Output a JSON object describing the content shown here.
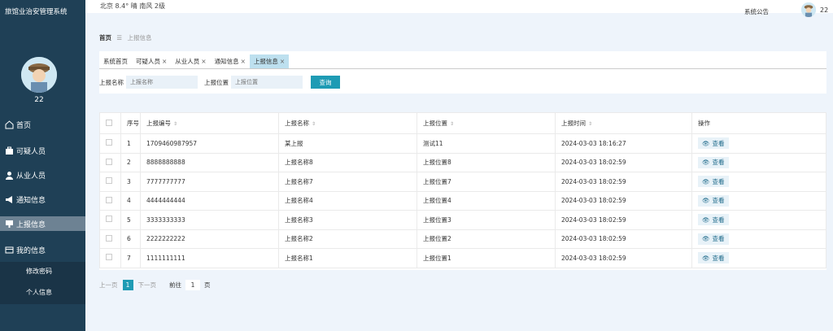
{
  "app": {
    "title": "旅馆业治安管理系统",
    "username": "22"
  },
  "sidebar": {
    "items": [
      {
        "label": "首页",
        "icon": "home-icon"
      },
      {
        "label": "可疑人员",
        "icon": "briefcase-icon"
      },
      {
        "label": "从业人员",
        "icon": "user-icon"
      },
      {
        "label": "通知信息",
        "icon": "megaphone-icon"
      },
      {
        "label": "上报信息",
        "icon": "report-icon"
      },
      {
        "label": "我的信息",
        "icon": "card-icon"
      }
    ],
    "subitems": [
      "修改密码",
      "个人信息"
    ]
  },
  "topbar": {
    "weather": "北京  8.4°  晴  南风  2级",
    "notice": "系统公告",
    "username": "22"
  },
  "breadcrumb": {
    "home": "首页",
    "sep": "☰",
    "current": "上报信息"
  },
  "tabs": [
    {
      "label": "系统首页",
      "closable": false
    },
    {
      "label": "可疑人员",
      "closable": true
    },
    {
      "label": "从业人员",
      "closable": true
    },
    {
      "label": "通知信息",
      "closable": true
    },
    {
      "label": "上报信息",
      "closable": true
    }
  ],
  "search": {
    "name_label": "上报名称",
    "name_placeholder": "上报名称",
    "location_label": "上报位置",
    "location_placeholder": "上报位置",
    "button": "查询"
  },
  "table": {
    "headers": [
      "序号",
      "上报编号",
      "上报名称",
      "上报位置",
      "上报时间",
      "操作"
    ],
    "view_label": "查看",
    "rows": [
      [
        "1",
        "1709460987957",
        "某上报",
        "测试11",
        "2024-03-03 18:16:27"
      ],
      [
        "2",
        "8888888888",
        "上报名称8",
        "上报位置8",
        "2024-03-03 18:02:59"
      ],
      [
        "3",
        "7777777777",
        "上报名称7",
        "上报位置7",
        "2024-03-03 18:02:59"
      ],
      [
        "4",
        "4444444444",
        "上报名称4",
        "上报位置4",
        "2024-03-03 18:02:59"
      ],
      [
        "5",
        "3333333333",
        "上报名称3",
        "上报位置3",
        "2024-03-03 18:02:59"
      ],
      [
        "6",
        "2222222222",
        "上报名称2",
        "上报位置2",
        "2024-03-03 18:02:59"
      ],
      [
        "7",
        "1111111111",
        "上报名称1",
        "上报位置1",
        "2024-03-03 18:02:59"
      ]
    ]
  },
  "pager": {
    "prev": "上一页",
    "page": "1",
    "next": "下一页",
    "goto": "前往",
    "goto_value": "1",
    "unit": "页"
  },
  "colors": {
    "sidebar": "#1f4056",
    "accent": "#1e9bb4",
    "active_tab": "#bde0ef"
  }
}
